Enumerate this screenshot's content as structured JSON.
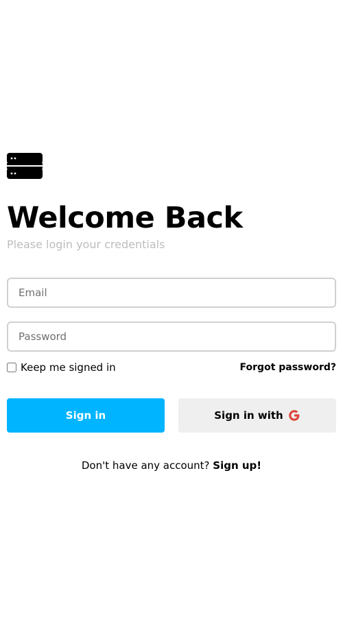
{
  "logo": {
    "icon": "server-stack-icon"
  },
  "header": {
    "title": "Welcome Back",
    "subtitle": "Please login your credentials"
  },
  "form": {
    "email_placeholder": "Email",
    "email_value": "",
    "password_placeholder": "Password",
    "password_value": "",
    "remember_label": "Keep me signed in",
    "remember_checked": false,
    "forgot_label": "Forgot password?"
  },
  "buttons": {
    "sign_in_label": "Sign in",
    "google_label": "Sign in with",
    "google_icon": "google-g-icon"
  },
  "footer": {
    "prompt_text": "Don't have any account?",
    "signup_label": "Sign up!"
  },
  "colors": {
    "primary": "#00b4ff",
    "secondary_button": "#efefef",
    "subtitle": "#bdbdbd",
    "google_red": "#db4437",
    "border": "#d0d0d0"
  }
}
